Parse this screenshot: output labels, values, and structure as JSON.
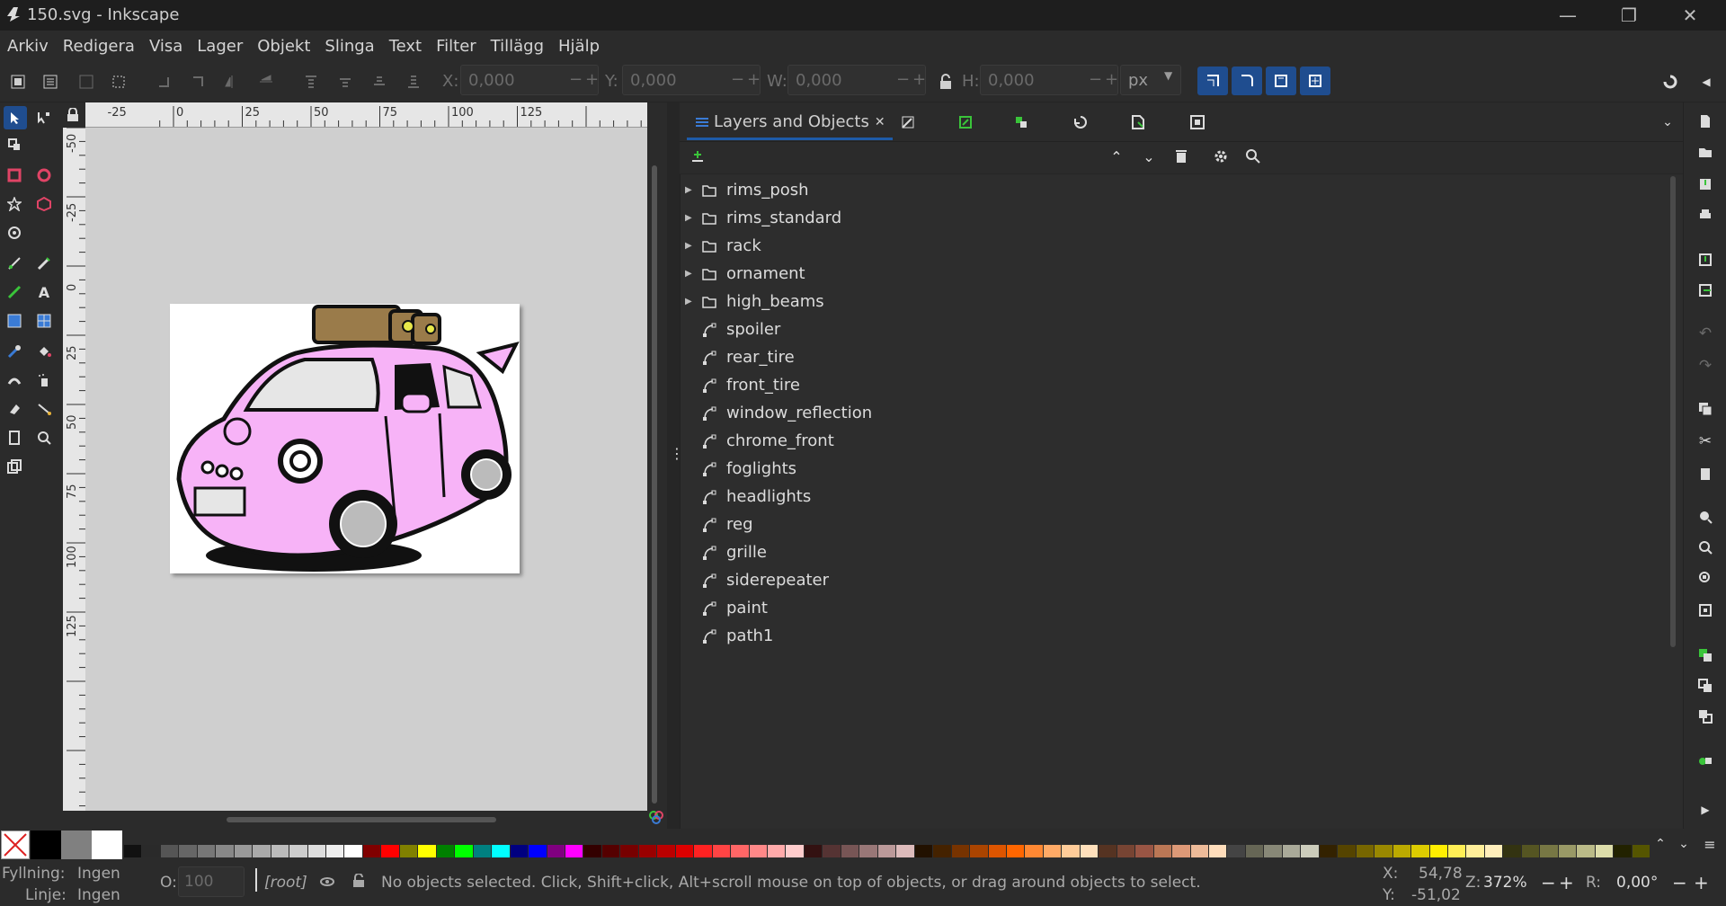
{
  "window": {
    "title": "150.svg - Inkscape",
    "minimize": "—",
    "restore": "❐",
    "close": "✕"
  },
  "menu": [
    "Arkiv",
    "Redigera",
    "Visa",
    "Lager",
    "Objekt",
    "Slinga",
    "Text",
    "Filter",
    "Tillägg",
    "Hjälp"
  ],
  "toolbar": {
    "x_label": "X:",
    "x_value": "0,000",
    "y_label": "Y:",
    "y_value": "0,000",
    "w_label": "W:",
    "w_value": "0,000",
    "h_label": "H:",
    "h_value": "0,000",
    "unit": "px",
    "minus": "−",
    "plus": "+"
  },
  "rulers": {
    "top_labels": [
      "-25",
      "0",
      "25",
      "50",
      "75",
      "100",
      "125"
    ],
    "left_labels": [
      "-50",
      "-25",
      "0",
      "25",
      "50",
      "75",
      "100",
      "125"
    ]
  },
  "panel": {
    "tab_label": "Layers and Objects",
    "tab_close": "✕",
    "layers": [
      {
        "name": "rims_posh",
        "kind": "group"
      },
      {
        "name": "rims_standard",
        "kind": "group"
      },
      {
        "name": "rack",
        "kind": "group"
      },
      {
        "name": "ornament",
        "kind": "group"
      },
      {
        "name": "high_beams",
        "kind": "group"
      },
      {
        "name": "spoiler",
        "kind": "path"
      },
      {
        "name": "rear_tire",
        "kind": "path"
      },
      {
        "name": "front_tire",
        "kind": "path"
      },
      {
        "name": "window_reflection",
        "kind": "path"
      },
      {
        "name": "chrome_front",
        "kind": "path"
      },
      {
        "name": "foglights",
        "kind": "path"
      },
      {
        "name": "headlights",
        "kind": "path"
      },
      {
        "name": "reg",
        "kind": "path"
      },
      {
        "name": "grille",
        "kind": "path"
      },
      {
        "name": "siderepeater",
        "kind": "path"
      },
      {
        "name": "paint",
        "kind": "path"
      },
      {
        "name": "path1",
        "kind": "path"
      }
    ]
  },
  "status": {
    "fill_label": "Fyllning:",
    "fill_value": "Ingen",
    "stroke_label": "Linje:",
    "stroke_value": "Ingen",
    "opacity_label": "O:",
    "opacity_value": "100",
    "layer": "[root]",
    "message": "No objects selected. Click, Shift+click, Alt+scroll mouse on top of objects, or drag around objects to select.",
    "x_label": "X:",
    "x_value": "54,78",
    "y_label": "Y:",
    "y_value": "-51,02",
    "zoom_label": "Z:",
    "zoom_value": "372%",
    "rotate_label": "R:",
    "rotate_value": "0,00°"
  },
  "colors": {
    "accent": "#1f4d8f",
    "car_body": "#f7b3f7",
    "roof_rack": "#9a7b4a"
  },
  "palette": [
    "#111111",
    "#2a2a2a",
    "#555555",
    "#666666",
    "#777777",
    "#888888",
    "#999999",
    "#aaaaaa",
    "#bbbbbb",
    "#cccccc",
    "#dddddd",
    "#eeeeee",
    "#ffffff",
    "#800000",
    "#ff0000",
    "#808000",
    "#ffff00",
    "#008000",
    "#00ff00",
    "#008080",
    "#00ffff",
    "#000080",
    "#0000ff",
    "#800080",
    "#ff00ff",
    "#330000",
    "#550000",
    "#770000",
    "#990000",
    "#bb0000",
    "#dd0000",
    "#ff2222",
    "#ff4444",
    "#ff6666",
    "#ff8888",
    "#ffaaaa",
    "#ffcccc",
    "#331111",
    "#553333",
    "#775555",
    "#997777",
    "#bb9999",
    "#ddbbbb",
    "#221100",
    "#442200",
    "#773300",
    "#aa4400",
    "#dd5500",
    "#ff6600",
    "#ff8833",
    "#ffaa66",
    "#ffcc99",
    "#ffe0bb",
    "#553322",
    "#774433",
    "#995544",
    "#bb7755",
    "#dd9977",
    "#eebb99",
    "#ffddbb",
    "#444444",
    "#666655",
    "#888877",
    "#aaaa99",
    "#ccccbb",
    "#332200",
    "#554400",
    "#776600",
    "#998800",
    "#bbaa00",
    "#ddcc00",
    "#ffee00",
    "#ffee55",
    "#ffee99",
    "#ffeebb",
    "#333311",
    "#555522",
    "#777744",
    "#999966",
    "#bbbb88",
    "#ddddaa",
    "#222200",
    "#555500"
  ]
}
